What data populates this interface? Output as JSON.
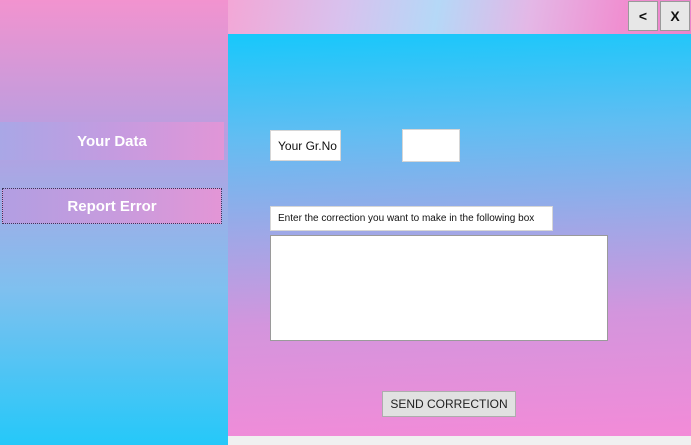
{
  "window": {
    "back_label": "<",
    "close_label": "X"
  },
  "sidebar": {
    "items": [
      {
        "label": "Your Data"
      },
      {
        "label": "Report Error"
      }
    ]
  },
  "form": {
    "gr_label": "Your Gr.No",
    "gr_value": "",
    "instruction": "Enter the correction you want to make in the following box",
    "correction_value": "",
    "send_label": "SEND CORRECTION"
  }
}
